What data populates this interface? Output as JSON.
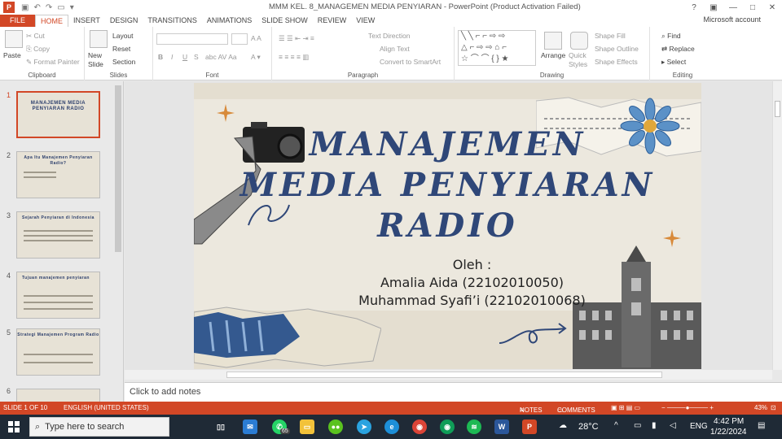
{
  "window": {
    "title": "MMM KEL. 8_MANAGEMEN MEDIA PENYIARAN - PowerPoint (Product Activation Failed)",
    "account": "Microsoft account",
    "app_icon": "P"
  },
  "tabs": [
    "FILE",
    "HOME",
    "INSERT",
    "DESIGN",
    "TRANSITIONS",
    "ANIMATIONS",
    "SLIDE SHOW",
    "REVIEW",
    "VIEW"
  ],
  "ribbon": {
    "clipboard": {
      "paste": "Paste",
      "cut": "Cut",
      "copy": "Copy",
      "format_painter": "Format Painter",
      "label": "Clipboard"
    },
    "slides": {
      "new_slide": "New Slide",
      "layout": "Layout",
      "reset": "Reset",
      "section": "Section",
      "label": "Slides"
    },
    "font": {
      "label": "Font",
      "bold": "B",
      "italic": "I",
      "underline": "U",
      "strike": "S"
    },
    "paragraph": {
      "text_direction": "Text Direction",
      "align_text": "Align Text",
      "convert_smartart": "Convert to SmartArt",
      "label": "Paragraph"
    },
    "drawing": {
      "arrange": "Arrange",
      "quick_styles": "Quick Styles",
      "shape_fill": "Shape Fill",
      "shape_outline": "Shape Outline",
      "shape_effects": "Shape Effects",
      "label": "Drawing"
    },
    "editing": {
      "find": "Find",
      "replace": "Replace",
      "select": "Select",
      "label": "Editing"
    }
  },
  "thumbnails": [
    {
      "num": "1",
      "title": "MANAJEMEN MEDIA PENYIARAN RADIO"
    },
    {
      "num": "2",
      "title": "Apa Itu Manajemen Penyiaran Radio?"
    },
    {
      "num": "3",
      "title": "Sejarah Penyiaran di Indonesia"
    },
    {
      "num": "4",
      "title": "Tujuan manajemen penyiaran"
    },
    {
      "num": "5",
      "title": "Strategi Manajemen Program Radio"
    },
    {
      "num": "6",
      "title": ""
    }
  ],
  "slide": {
    "title_line1": "MANAJEMEN",
    "title_line2": "MEDIA PENYIARAN",
    "title_line3": "RADIO",
    "oleh": "Oleh :",
    "author1": "Amalia Aida (22102010050)",
    "author2": "Muhammad Syafi’i (22102010068)"
  },
  "notes_placeholder": "Click to add notes",
  "status": {
    "slide_info": "SLIDE 1 OF 10",
    "language": "ENGLISH (UNITED STATES)",
    "notes": "NOTES",
    "comments": "COMMENTS",
    "zoom": "43%"
  },
  "taskbar": {
    "search_placeholder": "Type here to search",
    "whatsapp_badge": "65",
    "weather": "28°C",
    "lang": "ENG",
    "time": "4:42 PM",
    "date": "1/22/2024"
  },
  "colors": {
    "accent": "#d24726",
    "title_blue": "#2f4778",
    "taskbar": "#1f2a36"
  }
}
